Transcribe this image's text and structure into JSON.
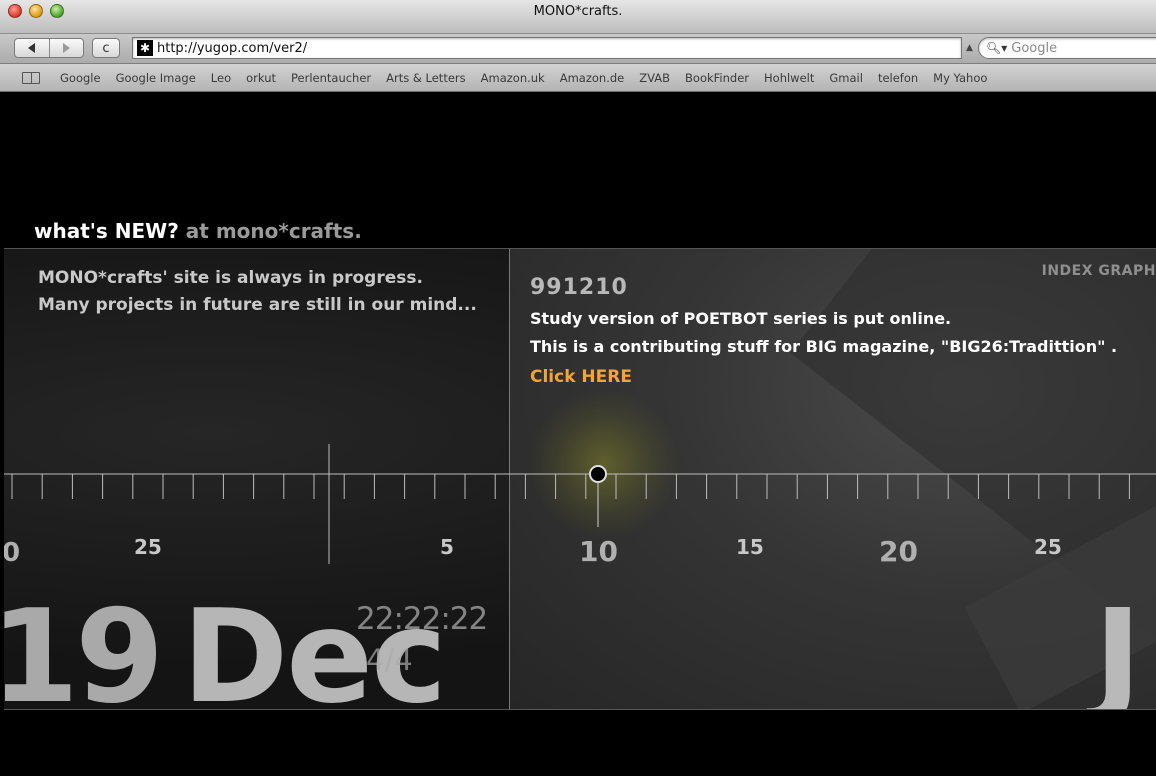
{
  "window": {
    "title": "MONO*crafts."
  },
  "toolbar": {
    "url": "http://yugop.com/ver2/",
    "search_placeholder": "Google",
    "reload_glyph": "c"
  },
  "bookmarks": [
    "Google",
    "Google Image",
    "Leo",
    "orkut",
    "Perlentaucher",
    "Arts & Letters",
    "Amazon.uk",
    "Amazon.de",
    "ZVAB",
    "BookFinder",
    "Hohlwelt",
    "Gmail",
    "telefon",
    "My Yahoo"
  ],
  "page": {
    "heading": "what's NEW?",
    "heading_sub": "at mono*crafts.",
    "intro_line1": "MONO*crafts' site is always in progress.",
    "intro_line2": "Many projects in future are still in our mind...",
    "index_label": "INDEX GRAPH",
    "entry": {
      "date": "991210",
      "line1": "Study version of POETBOT series is put online.",
      "line2": "This is a contributing stuff for BIG magazine, \"BIG26:Tradittion\" .",
      "link": "Click HERE"
    },
    "timeline": {
      "labels": [
        {
          "text": "0"
        },
        {
          "text": "25"
        },
        {
          "text": "5"
        },
        {
          "text": "10"
        },
        {
          "text": "15"
        },
        {
          "text": "20"
        },
        {
          "text": "25"
        }
      ]
    },
    "big_day": "19",
    "big_month": "Dec",
    "big_day_ghost": "9",
    "next_month": "J",
    "clock": "22:22:22",
    "fraction": "4/4"
  },
  "colors": {
    "link": "#f0a43a",
    "heading_sub": "#9a9a9a",
    "background": "#000000"
  }
}
